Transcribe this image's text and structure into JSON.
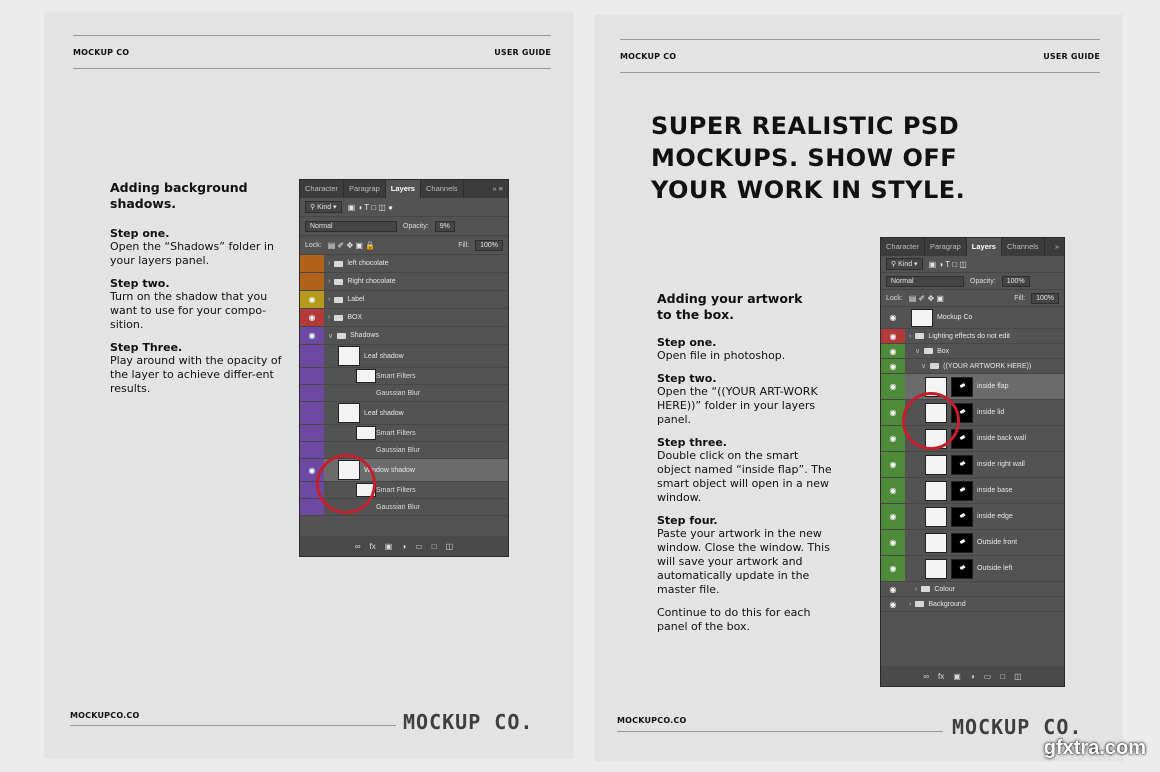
{
  "left_page": {
    "brand": "MOCKUP CO",
    "header_right": "USER GUIDE",
    "heading": "Adding background shadows.",
    "steps": [
      {
        "title": "Step one.",
        "body": "Open the “Shadows” folder in your layers panel."
      },
      {
        "title": "Step two.",
        "body": "Turn on the shadow that you want to use for your compo-sition."
      },
      {
        "title": "Step Three.",
        "body": "Play around with the opacity of the layer to achieve differ-ent results."
      }
    ],
    "footer_url": "MOCKUPCO.CO",
    "logo": "MOCKUP CO."
  },
  "right_page": {
    "brand": "MOCKUP CO",
    "header_right": "USER GUIDE",
    "title_lines": [
      "SUPER REALISTIC PSD",
      "MOCKUPS. SHOW OFF",
      "YOUR WORK IN STYLE."
    ],
    "heading": "Adding your artwork to the box.",
    "steps": [
      {
        "title": "Step one.",
        "body": "Open file in photoshop."
      },
      {
        "title": "Step two.",
        "body": "Open the “((YOUR ART-WORK HERE))” folder in your layers panel."
      },
      {
        "title": "Step three.",
        "body": "Double click on the smart object named “inside flap”. The smart object will open in a new window."
      },
      {
        "title": "Step four.",
        "body": "Paste your artwork in the new window. Close the window. This will save your artwork and automatically update in the master file."
      },
      {
        "title": "",
        "body": "Continue to do this for each panel of the box."
      }
    ],
    "footer_url": "MOCKUPCO.CO",
    "logo": "MOCKUP CO."
  },
  "panel_left": {
    "tabs": [
      "Character",
      "Paragrap",
      "Layers",
      "Channels"
    ],
    "active_tab": "Layers",
    "filter": "Kind",
    "blend": "Normal",
    "opacity_label": "Opacity:",
    "opacity": "9%",
    "lock_label": "Lock:",
    "fill_label": "Fill:",
    "fill": "100%",
    "layers": [
      {
        "name": "left chocolate",
        "color": "#b0621b",
        "eye": false
      },
      {
        "name": "Right chocolate",
        "color": "#b0621b",
        "eye": false
      },
      {
        "name": "Label",
        "color": "#b59a1c",
        "eye": true
      },
      {
        "name": "BOX",
        "color": "#b33a3a",
        "eye": true
      },
      {
        "name": "Shadows",
        "color": "#6d4aa1",
        "eye": true
      }
    ],
    "shadow_layers": [
      {
        "name": "Leaf shadow",
        "filters": "Smart Filters",
        "blur": "Gaussian Blur"
      },
      {
        "name": "Leaf shadow",
        "filters": "Smart Filters",
        "blur": "Gaussian Blur"
      },
      {
        "name": "Window shadow",
        "filters": "Smart Filters",
        "blur": "Gaussian Blur"
      }
    ]
  },
  "panel_right": {
    "tabs": [
      "Character",
      "Paragrap",
      "Layers",
      "Channels"
    ],
    "active_tab": "Layers",
    "filter": "Kind",
    "blend": "Normal",
    "opacity_label": "Opacity:",
    "opacity": "100%",
    "lock_label": "Lock:",
    "fill_label": "Fill:",
    "fill": "100%",
    "top_layers": [
      {
        "name": "Mockup Co"
      },
      {
        "name": "Lighting effects do not edit"
      },
      {
        "name": "Box"
      },
      {
        "name": "((YOUR ARTWORK HERE))"
      }
    ],
    "art_layers": [
      "inside flap",
      "inside lid",
      "inside back wall",
      "inside right wall",
      "inside base",
      "inside edge",
      "Outside front",
      "Outside left"
    ],
    "bottom_layers": [
      "Colour",
      "Background"
    ]
  },
  "watermark": "gfxtra.com",
  "colors": {
    "ring": "#c41f2e",
    "green": "#4e8a3a",
    "panel": "#535353"
  }
}
